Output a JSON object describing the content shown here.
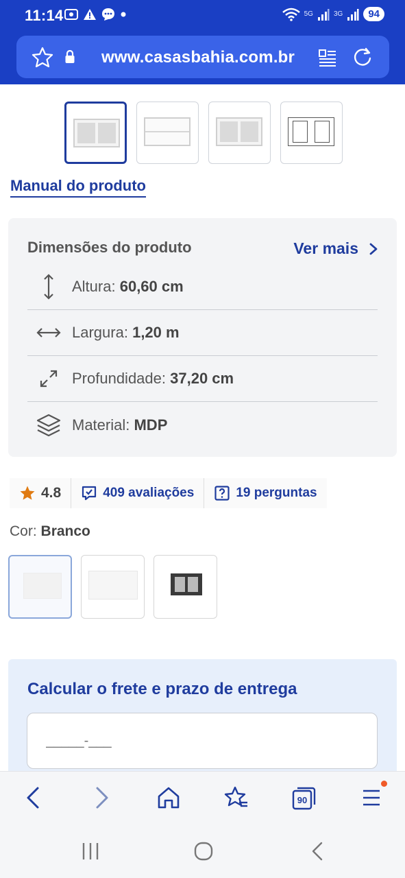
{
  "status_bar": {
    "time": "11:14",
    "battery": "94",
    "net_5g": "5G",
    "net_3g": "3G"
  },
  "browser": {
    "url": "www.casasbahia.com.br"
  },
  "thumbnails": [
    {
      "name": "thumb-glass-cabinet"
    },
    {
      "name": "thumb-open-cabinet"
    },
    {
      "name": "thumb-glass-cabinet-2"
    },
    {
      "name": "thumb-dimensions-drawing"
    }
  ],
  "product": {
    "manual_link": "Manual do produto",
    "dimensions": {
      "title": "Dimensões do produto",
      "see_more": "Ver mais",
      "rows": [
        {
          "icon": "vertical-arrows-icon",
          "label": "Altura:",
          "value": "60,60 cm"
        },
        {
          "icon": "horizontal-arrows-icon",
          "label": "Largura:",
          "value": "1,20 m"
        },
        {
          "icon": "diagonal-arrows-icon",
          "label": "Profundidade:",
          "value": "37,20 cm"
        },
        {
          "icon": "layers-icon",
          "label": "Material:",
          "value": "MDP"
        }
      ]
    },
    "rating": {
      "value": "4.8",
      "reviews": "409 avaliações",
      "questions": "19 perguntas"
    },
    "color": {
      "label": "Cor:",
      "value": "Branco"
    }
  },
  "shipping": {
    "title": "Calcular o frete e prazo de entrega",
    "placeholder": "_____-___"
  },
  "bottom_nav": {
    "tabs_count": "90"
  },
  "colors": {
    "brand_blue": "#1a3fc4",
    "link_blue": "#1f3c9e",
    "star": "#e07b12",
    "notification": "#f05a28"
  }
}
